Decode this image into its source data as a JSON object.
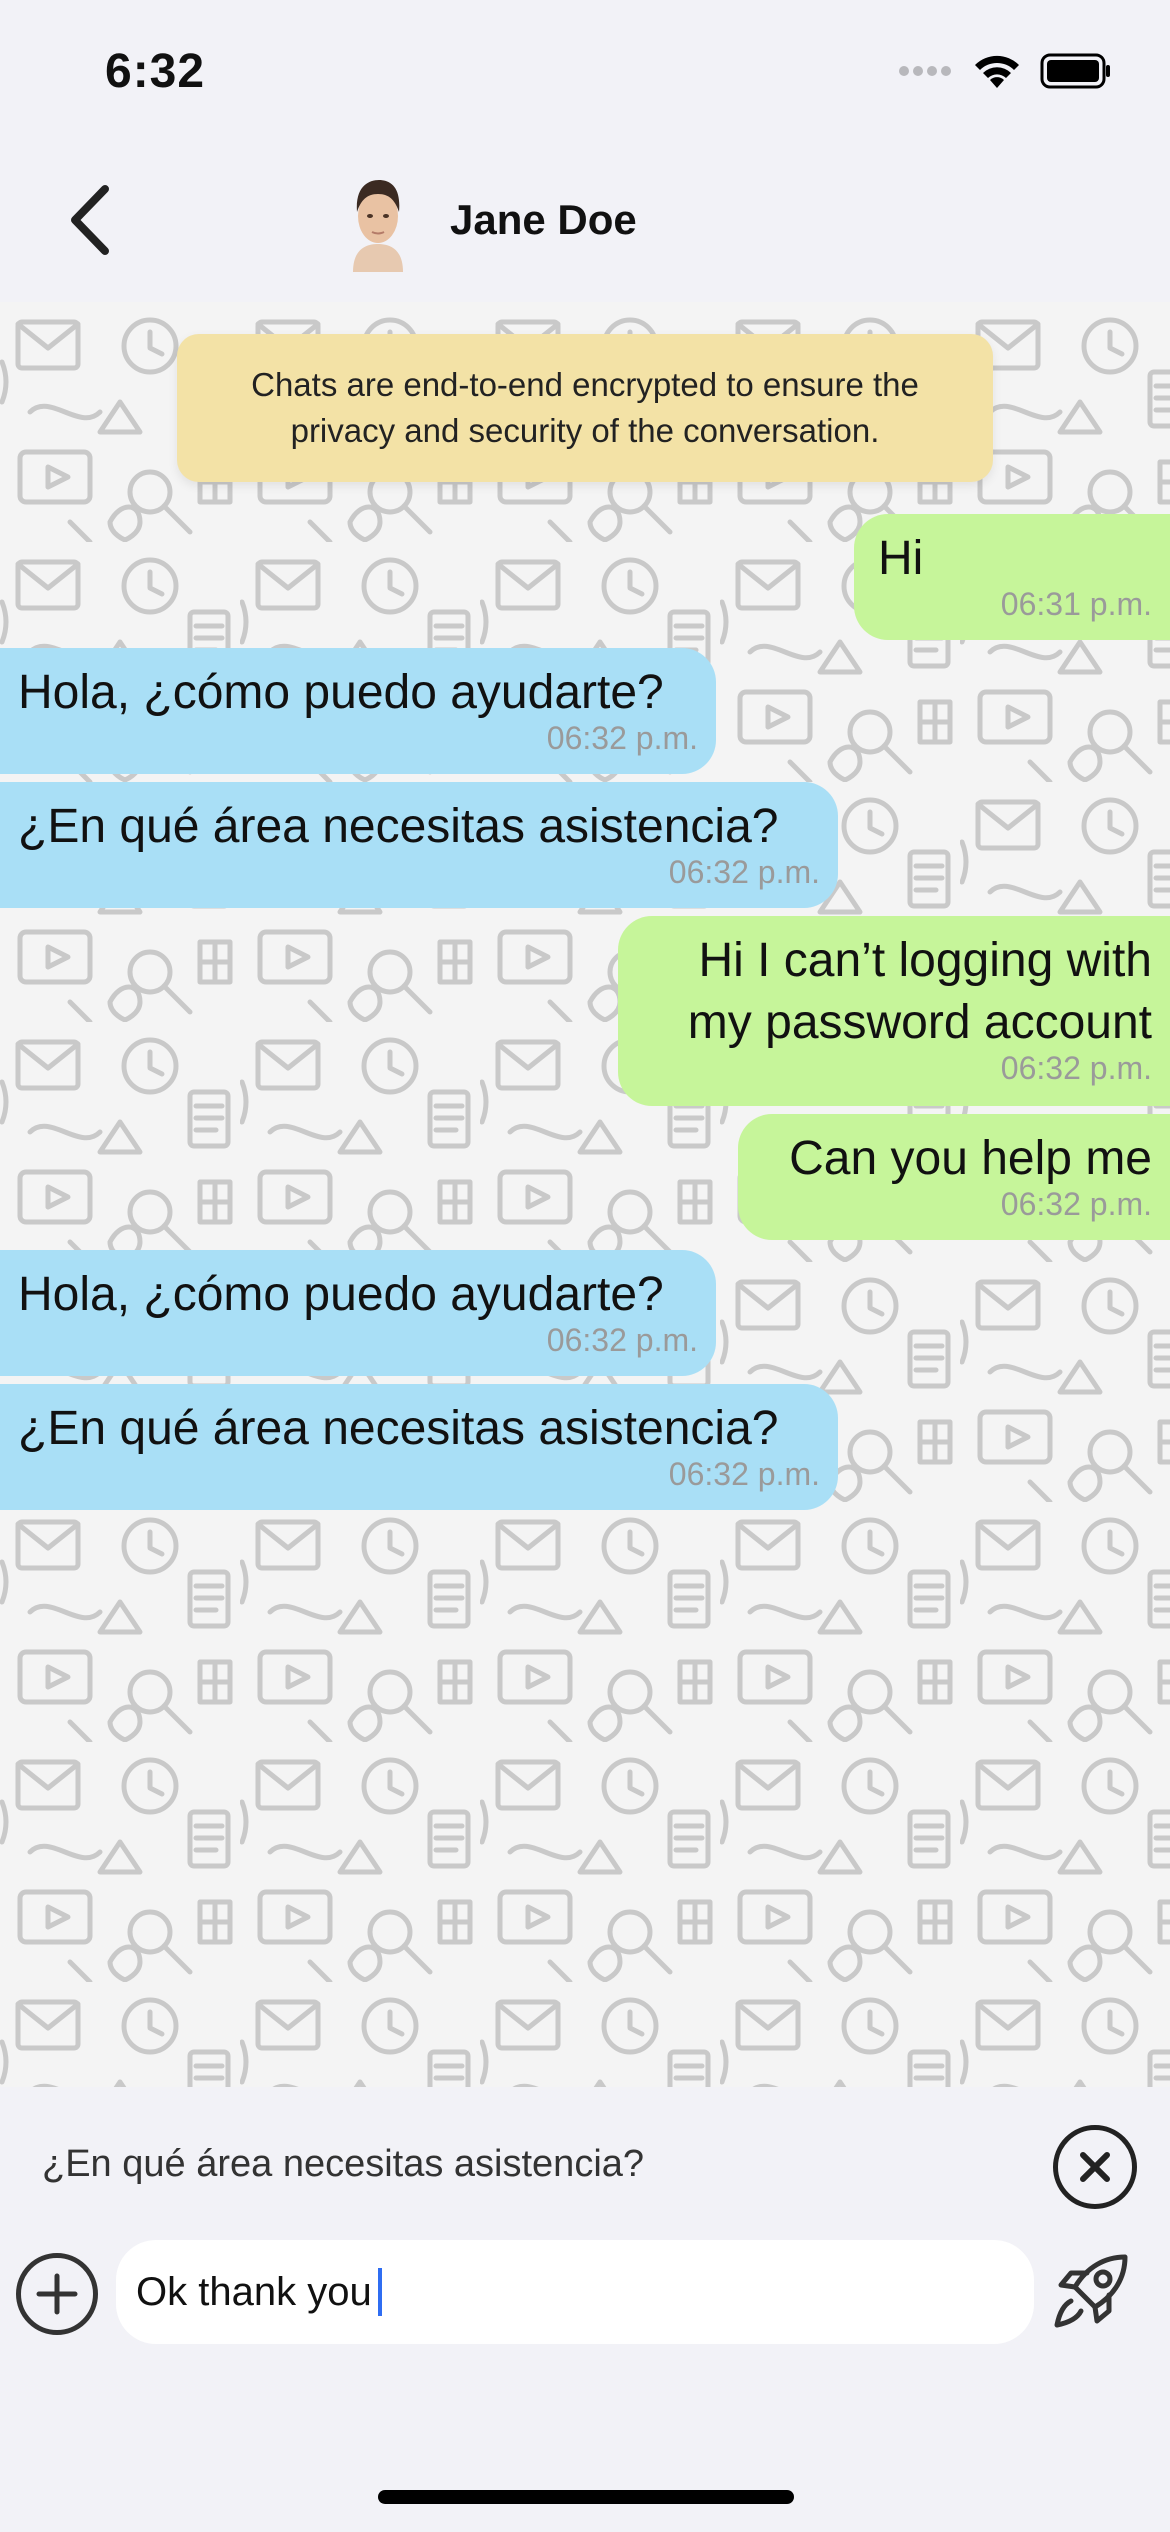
{
  "status_bar": {
    "time": "6:32",
    "icons": [
      "signal-dots-icon",
      "wifi-icon",
      "battery-icon"
    ]
  },
  "header": {
    "back_icon": "chevron-left-icon",
    "contact_name": "Jane Doe",
    "avatar": "person-avatar"
  },
  "chat": {
    "encryption_notice": "Chats are end-to-end encrypted to ensure the privacy and security of the conversation.",
    "messages": [
      {
        "direction": "out",
        "text": "Hi",
        "time": "06:31 p.m."
      },
      {
        "direction": "in",
        "text": "Hola, ¿cómo puedo ayudarte?",
        "time": "06:32 p.m."
      },
      {
        "direction": "in",
        "text": "¿En qué área necesitas asistencia?",
        "time": "06:32 p.m."
      },
      {
        "direction": "out",
        "text": "Hi I can’t logging with my password account",
        "time": "06:32 p.m."
      },
      {
        "direction": "out",
        "text": "Can you help me",
        "time": "06:32 p.m."
      },
      {
        "direction": "in",
        "text": "Hola, ¿cómo puedo ayudarte?",
        "time": "06:32 p.m."
      },
      {
        "direction": "in",
        "text": "¿En qué área necesitas asistencia?",
        "time": "06:32 p.m."
      }
    ],
    "colors": {
      "outgoing": "#c6f59a",
      "incoming": "#a9dff6",
      "notice": "#f3e2a6"
    }
  },
  "reply": {
    "quoted_text": "¿En qué área necesitas asistencia?",
    "close_icon": "close-circle-icon"
  },
  "composer": {
    "value": "Ok thank you",
    "add_icon": "plus-circle-icon",
    "send_icon": "rocket-icon"
  }
}
